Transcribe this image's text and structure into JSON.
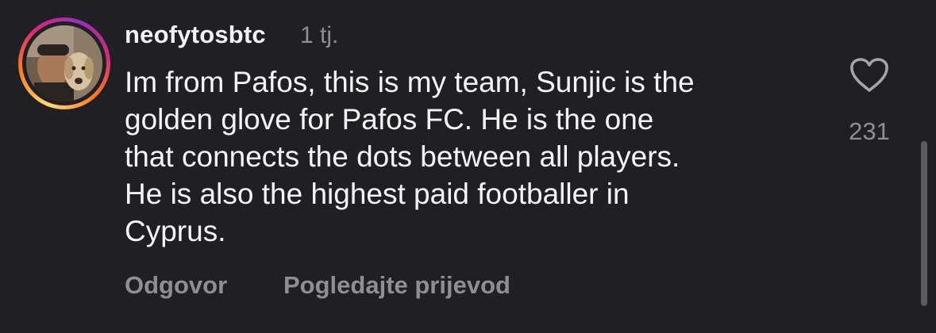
{
  "comment": {
    "username": "neofytosbtc",
    "time": "1 tj.",
    "text_lines": [
      "Im from Pafos, this is my team, Sunjic is the",
      "golden glove for Pafos FC. He is the one",
      "that connects the dots between all players.",
      "He is also the highest paid footballer in",
      "Cyprus."
    ],
    "like_count": "231",
    "actions": {
      "reply": "Odgovor",
      "translate": "Pogledajte prijevod"
    },
    "has_story_ring": true
  },
  "icons": {
    "like": "heart-outline-icon"
  },
  "colors": {
    "background": "#202024",
    "primary_text": "#f5f5f5",
    "secondary_text": "#8e8e93",
    "scrollbar": "#5b5b60"
  }
}
